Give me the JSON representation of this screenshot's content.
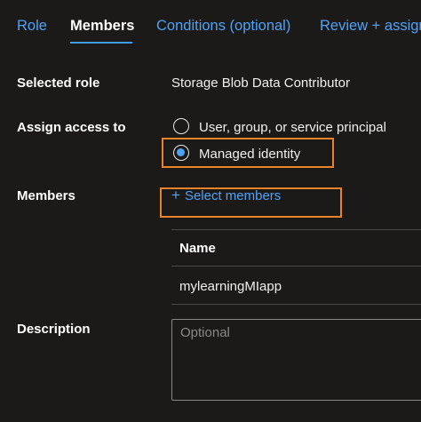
{
  "tabs": [
    {
      "label": "Role"
    },
    {
      "label": "Members"
    },
    {
      "label": "Conditions (optional)"
    },
    {
      "label": "Review + assign"
    }
  ],
  "form": {
    "selected_role_label": "Selected role",
    "selected_role_value": "Storage Blob Data Contributor",
    "assign_access_label": "Assign access to",
    "assign_options": [
      {
        "label": "User, group, or service principal",
        "selected": false
      },
      {
        "label": "Managed identity",
        "selected": true
      }
    ],
    "members_label": "Members",
    "select_members_text": "Select members",
    "members_table": {
      "columns": [
        "Name"
      ],
      "rows": [
        [
          "mylearningMIapp"
        ]
      ]
    },
    "description_label": "Description",
    "description_placeholder": "Optional"
  },
  "colors": {
    "background": "#1b1a19",
    "accent": "#4fa3f7",
    "highlight": "#e8832a"
  }
}
